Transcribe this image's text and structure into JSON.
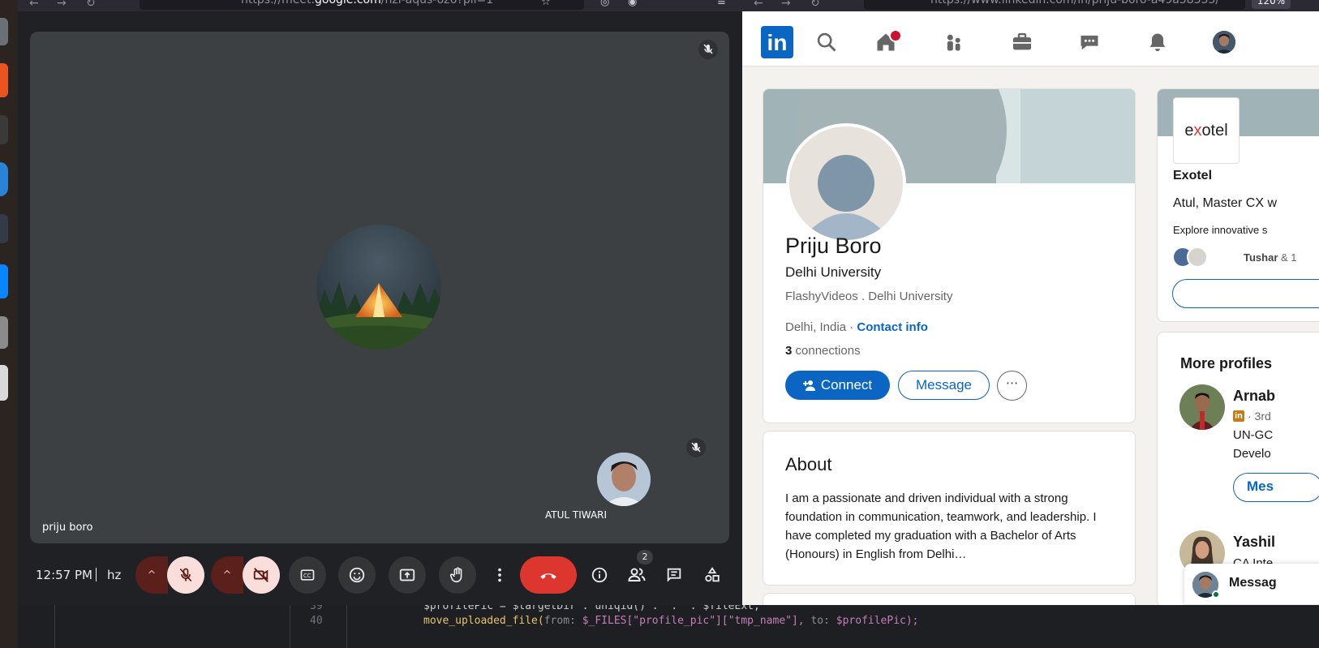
{
  "meet": {
    "url_prefix": "https://meet.",
    "url_domain": "google.com",
    "url_path": "/hzi-aqus-oz6?pli=1",
    "main_participant_name": "priju boro",
    "self_participant_name": "ATUL TIWARI",
    "clock": "12:57 PM",
    "meeting_code": "hz",
    "people_count": "2",
    "controls": [
      "mic-options",
      "mic-muted",
      "camera-options",
      "camera-off",
      "captions",
      "emoji",
      "present",
      "raise-hand",
      "more-options",
      "end-call",
      "meeting-info",
      "people",
      "chat",
      "activities"
    ],
    "colors": {
      "end_call": "#dc362e",
      "muted": "#f9dedc",
      "tile": "#3c4043"
    }
  },
  "linkedin": {
    "url": "https://www.linkedin.com/in/priju-boro-a49a58355/",
    "zoom": "120%",
    "logo": "in",
    "nav_icons": [
      "search-icon",
      "home-icon",
      "people-icon",
      "jobs-icon",
      "messaging-icon",
      "notifications-icon",
      "me-avatar"
    ],
    "profile": {
      "name": "Priju Boro",
      "headline": "Delhi University",
      "experience": "FlashyVideos . Delhi University",
      "location": "Delhi, India · ",
      "contact_info": "Contact info",
      "connections_count": "3",
      "connections_label": " connections",
      "connect_label": "Connect",
      "message_label": "Message",
      "more_label": "···"
    },
    "about": {
      "title": "About",
      "text": "I am a passionate and driven individual with a strong foundation in communication, teamwork, and leadership. I have completed my graduation with a Bachelor of Arts (Honours) in English from Delhi…"
    },
    "ad": {
      "logo_text_pre": "e",
      "logo_text_x": "x",
      "logo_text_post": "otel",
      "company": "Exotel",
      "line": "Atul, Master CX w",
      "sub": "Explore innovative s",
      "follower_name": "Tushar",
      "follower_rest": " & 1"
    },
    "more_profiles": {
      "title": "More profiles",
      "p1_name": "Arnab",
      "p1_degree": "· 3rd",
      "p1_line1": "UN-GC",
      "p1_line2": "Develo",
      "p1_message": "Mes",
      "p2_name": "Yashil",
      "p2_line1": "CA Inte"
    },
    "messaging_overlay": "Messag",
    "colors": {
      "brand": "#0a66c2",
      "cover": "#a0b4b7"
    }
  },
  "editor": {
    "line39_no": "39",
    "line39": "$profilePic = $targetDir . uniqid() . '.' . $fileExt;",
    "line40_no": "40",
    "line40_a": "move_uploaded_file(",
    "line40_hint1": "from: ",
    "line40_b": "$_FILES[\"profile_pic\"][\"tmp_name\"], ",
    "line40_hint2": "to: ",
    "line40_c": "$profilePic);"
  }
}
